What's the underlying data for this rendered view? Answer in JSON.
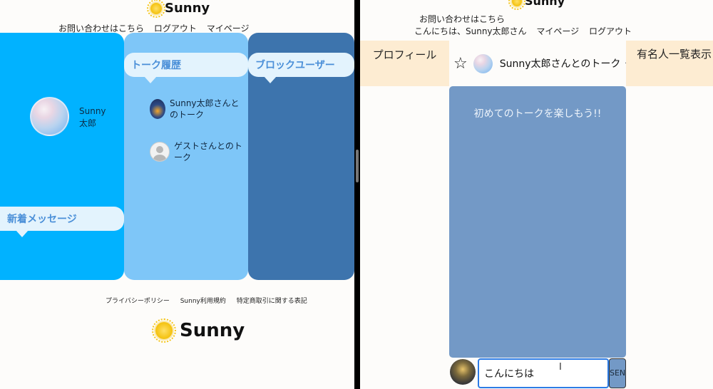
{
  "left": {
    "logo_text": "Sunny",
    "nav": {
      "contact": "お問い合わせはこちら",
      "logout": "ログアウト",
      "mypage": "マイページ"
    },
    "profile": {
      "name": "Sunny\n太郎"
    },
    "sections": {
      "talk_history": "トーク履歴",
      "blocked_users": "ブロックユーザー",
      "new_messages": "新着メッセージ"
    },
    "talks": [
      {
        "label": "Sunny太郎さんとのトーク"
      },
      {
        "label": "ゲストさんとのトーク"
      }
    ],
    "footer": {
      "links": [
        "プライバシーポリシー",
        "Sunny利用規約",
        "特定商取引に関する表記"
      ],
      "logo_text": "Sunny"
    },
    "colors": {
      "col1": "#01b2ff",
      "col2": "#7ec6f8",
      "col3": "#3d74ad",
      "bubble": "#e3f3fd",
      "bubble_text": "#4a8fd8"
    }
  },
  "right": {
    "logo_text": "Sunny",
    "contact": "お問い合わせはこちら",
    "greeting": "こんにちは、Sunny太郎さん",
    "mypage": "マイページ",
    "logout": "ログアウト",
    "tab_profile": "プロフィール",
    "star": "☆",
    "talk_title": "Sunny太郎さんとのトーク",
    "chevron": "⌄",
    "tab_famous": "有名人一覧表示",
    "empty_message": "初めてのトークを楽しもう!!",
    "input_value": "こんにちは",
    "send_label": "SEND",
    "colors": {
      "tabs": "#fdecd2",
      "chat_bg": "#7399c6",
      "input_border": "#2c7be5"
    }
  }
}
